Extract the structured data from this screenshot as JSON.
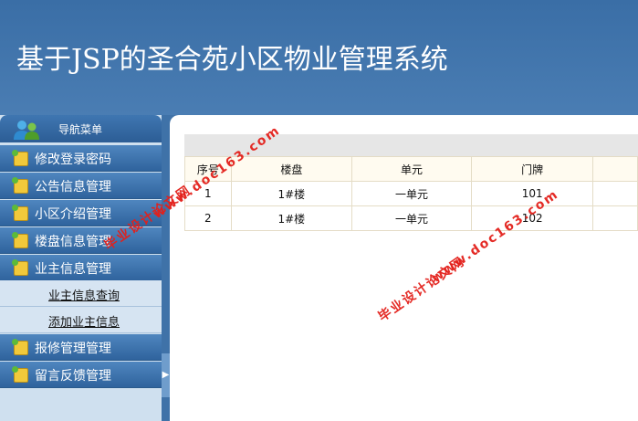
{
  "header": {
    "title": "基于JSP的圣合苑小区物业管理系统"
  },
  "sidebar": {
    "nav_title": "导航菜单",
    "items": [
      {
        "label": "修改登录密码"
      },
      {
        "label": "公告信息管理"
      },
      {
        "label": "小区介绍管理"
      },
      {
        "label": "楼盘信息管理"
      },
      {
        "label": "业主信息管理"
      },
      {
        "label": "报修管理管理"
      },
      {
        "label": "留言反馈管理"
      }
    ],
    "sub_items": [
      {
        "label": "业主信息查询"
      },
      {
        "label": "添加业主信息"
      }
    ]
  },
  "table": {
    "columns": [
      "序号",
      "楼盘",
      "单元",
      "门牌",
      ""
    ],
    "rows": [
      [
        "1",
        "1#楼",
        "一单元",
        "101",
        ""
      ],
      [
        "2",
        "1#楼",
        "一单元",
        "102",
        ""
      ]
    ]
  },
  "watermark": {
    "url": "www.doc163.com",
    "text": "毕业设计论文网",
    "color": "#e3201b"
  }
}
